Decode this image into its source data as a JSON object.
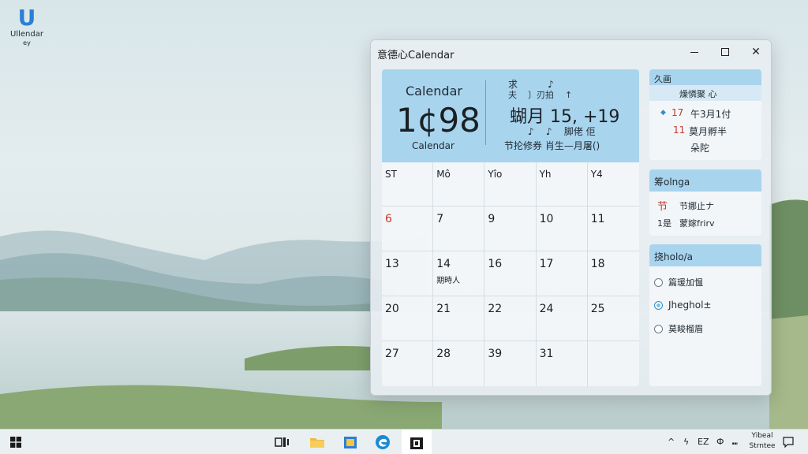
{
  "desktop": {
    "icon": {
      "glyph": "U",
      "label": "Ullendar",
      "sub": "ey"
    }
  },
  "window": {
    "title": "意德心Calendar",
    "controls": {
      "minimize": "minimize-icon",
      "maximize": "maximize-icon",
      "close": "✕"
    }
  },
  "calendar": {
    "header": {
      "label": "Calendar",
      "big_number": "1¢98",
      "sub_label": "Calendar",
      "right_line1": "求          ♪",
      "right_line1b": "夫    〕刃拍    ↑",
      "date": "蝴月 15, +19",
      "right_line2": "♪    ♪    脚佬 佢",
      "right_line3": "节抡修券 肖生—月屠()"
    },
    "weekday_headers": [
      "ST",
      "Mô",
      "Yîo",
      "Yh",
      "Y4"
    ],
    "weeks": [
      [
        {
          "d": "6",
          "red": true
        },
        {
          "d": "7"
        },
        {
          "d": "9"
        },
        {
          "d": "10"
        },
        {
          "d": "11"
        }
      ],
      [
        {
          "d": "13"
        },
        {
          "d": "14",
          "note": "期時人"
        },
        {
          "d": "16"
        },
        {
          "d": "17"
        },
        {
          "d": "18"
        }
      ],
      [
        {
          "d": "20"
        },
        {
          "d": "21"
        },
        {
          "d": "22"
        },
        {
          "d": "24"
        },
        {
          "d": "25"
        }
      ],
      [
        {
          "d": "27"
        },
        {
          "d": "28"
        },
        {
          "d": "39"
        },
        {
          "d": "31"
        },
        {
          "d": ""
        }
      ]
    ]
  },
  "panel_events": {
    "title": "久画",
    "subtitle": "燥憐聚 心",
    "lines": [
      {
        "num": "17",
        "text": "午3月1付"
      },
      {
        "num": "11",
        "text": "莫月孵半"
      },
      {
        "num": "",
        "text": "朵陀"
      }
    ]
  },
  "panel_notes": {
    "title": "筹olnga",
    "lines": [
      {
        "mark": "节",
        "text": "节娜止ナ"
      },
      {
        "mark": "1是",
        "text": "蒙嫁frirv"
      }
    ]
  },
  "panel_options": {
    "title": "挠holo/a",
    "options": [
      {
        "label": "篇瑗加愠",
        "selected": false
      },
      {
        "label": "Jheghol±",
        "selected": true
      },
      {
        "label": "莫睃榴眉",
        "selected": false
      }
    ]
  },
  "taskbar": {
    "tray_text": [
      "^",
      "ϟ",
      "EZ",
      "Ф",
      "⑉"
    ],
    "clock_line1": "Yibeal",
    "clock_line2": "Strntee",
    "colors": {
      "accent": "#a9d4ee",
      "edge": "#2b7fd4",
      "date_red": "#c0392b"
    }
  }
}
